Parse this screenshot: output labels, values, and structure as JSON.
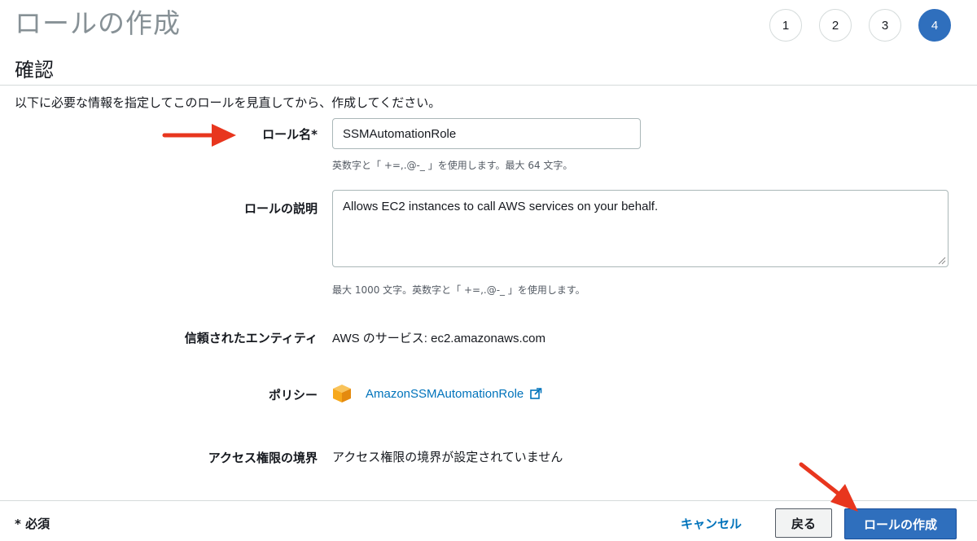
{
  "header": {
    "title": "ロールの作成",
    "steps": [
      "1",
      "2",
      "3",
      "4"
    ],
    "active_step": "4"
  },
  "review": {
    "section_title": "確認",
    "intro": "以下に必要な情報を指定してこのロールを見直してから、作成してください。"
  },
  "form": {
    "role_name": {
      "label": "ロール名*",
      "value": "SSMAutomationRole",
      "hint": "英数字と「 +=,.@-_ 」を使用します。最大 64 文字。"
    },
    "role_description": {
      "label": "ロールの説明",
      "value": "Allows EC2 instances to call AWS services on your behalf.",
      "hint": "最大 1000 文字。英数字と「 +=,.@-_ 」を使用します。"
    },
    "trusted_entity": {
      "label": "信頼されたエンティティ",
      "value": "AWS のサービス: ec2.amazonaws.com"
    },
    "policy": {
      "label": "ポリシー",
      "link": "AmazonSSMAutomationRole",
      "icon": "policy-cube-icon"
    },
    "permission_boundary": {
      "label": "アクセス権限の境界",
      "value": "アクセス権限の境界が設定されていません"
    }
  },
  "footer": {
    "required_note": "* 必須",
    "cancel_label": "キャンセル",
    "back_label": "戻る",
    "create_label": "ロールの作成"
  },
  "colors": {
    "primary": "#2f6fbd",
    "link": "#0073bb",
    "annotation_arrow": "#e8361e",
    "policy_icon": "#f7a81b"
  }
}
